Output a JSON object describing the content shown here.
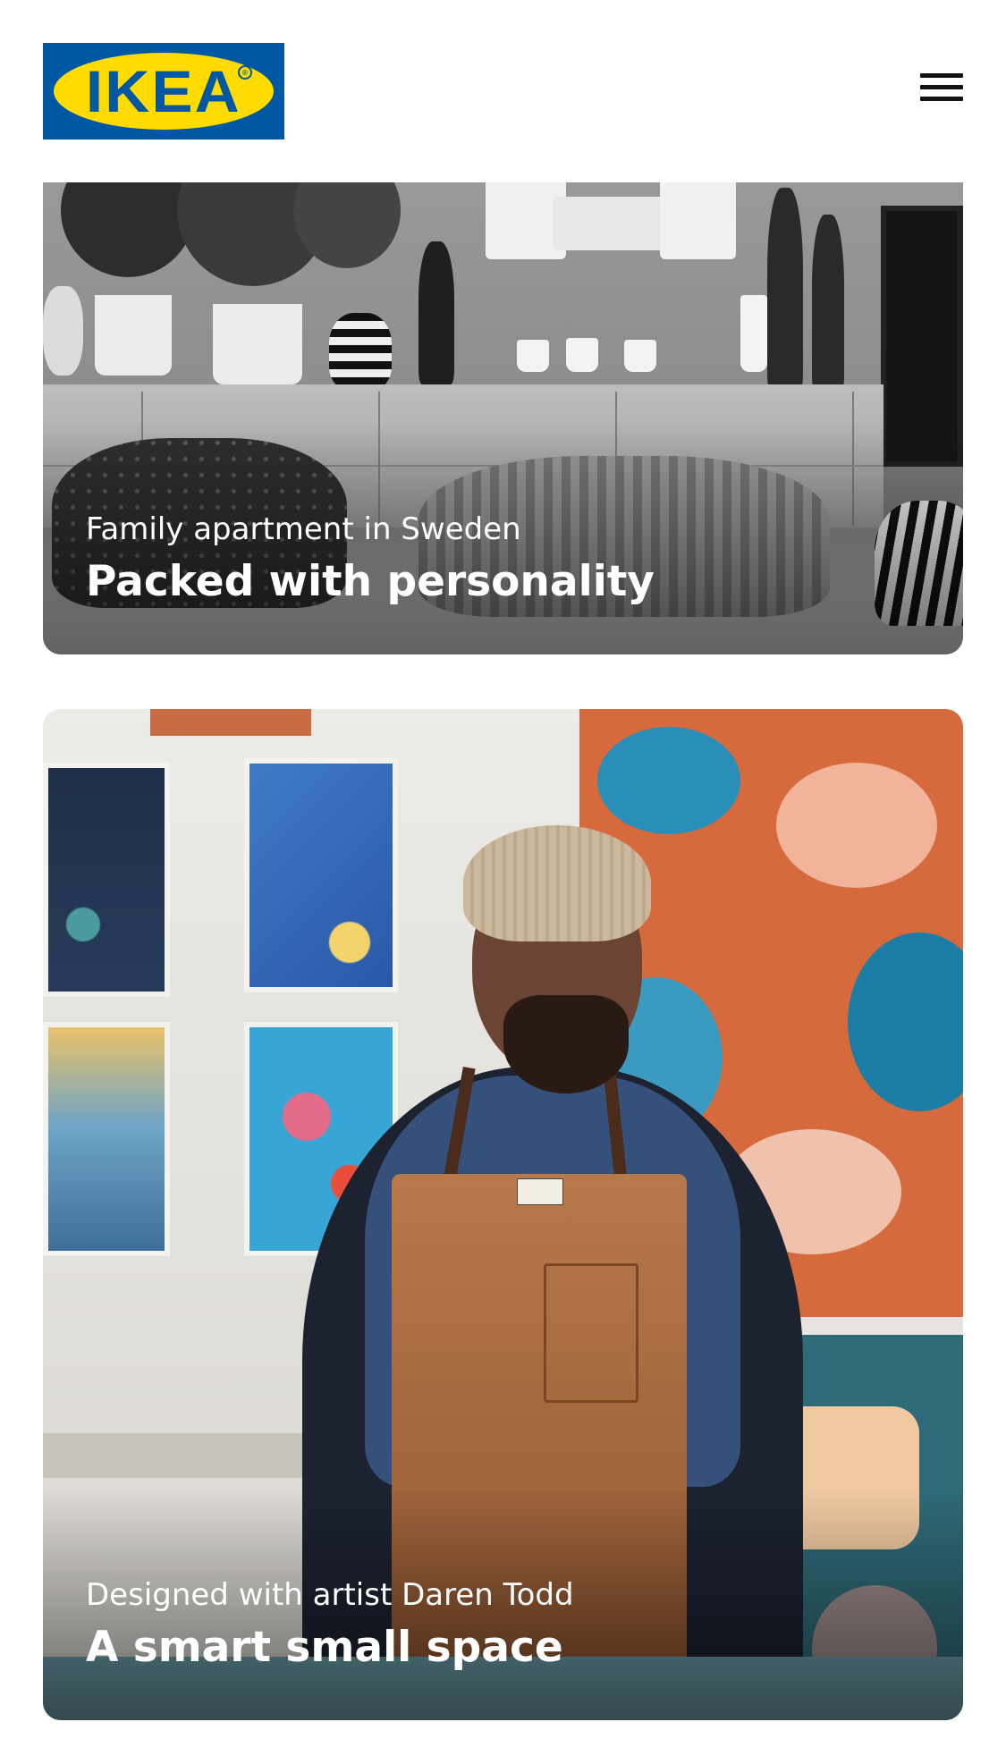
{
  "header": {
    "logo_text": "IKEA",
    "logo_mark": "®",
    "menu_icon": "hamburger-menu-icon"
  },
  "colors": {
    "ikea_blue": "#0058A3",
    "ikea_yellow": "#FFDB00",
    "text_on_image": "#ffffff"
  },
  "cards": [
    {
      "subtitle": "Family apartment in Sweden",
      "title": "Packed with personality"
    },
    {
      "subtitle": "Designed with artist Daren Todd",
      "title": "A smart small space"
    }
  ]
}
